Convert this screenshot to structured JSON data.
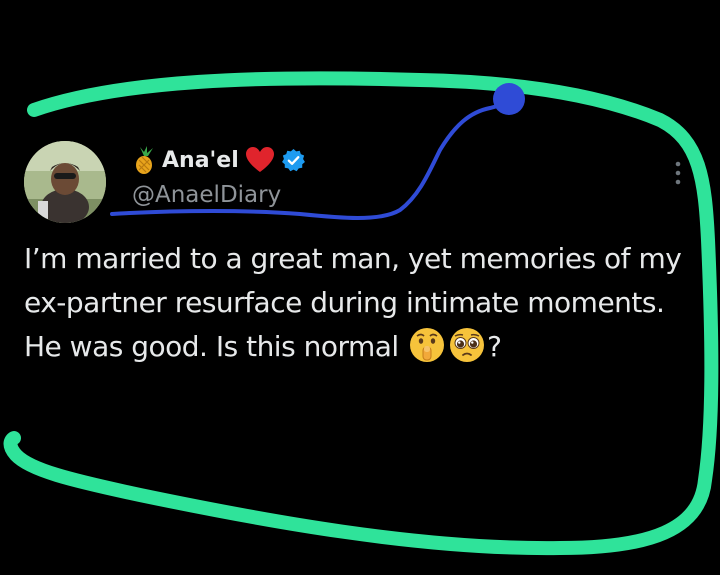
{
  "author": {
    "display_name": "Ana'el",
    "handle": "@AnaelDiary",
    "name_prefix_icon": "pineapple-icon",
    "name_suffix_icons": [
      "red-heart-icon",
      "verified-badge-icon"
    ]
  },
  "tweet": {
    "text": "I’m married to a great man, yet memories of my ex-partner resurface during intimate moments. He was good. Is this normal",
    "trailing_emojis": [
      "shushing-face-icon",
      "pleading-face-icon"
    ],
    "trailing_text": "?"
  },
  "annotations": {
    "outline_color": "#2fe39a",
    "scribble_color": "#2f4bd6"
  },
  "colors": {
    "background": "#000000",
    "text": "#e7e9ea",
    "muted": "#8f9499",
    "verified": "#1d9bf0",
    "heart": "#e0242c"
  }
}
